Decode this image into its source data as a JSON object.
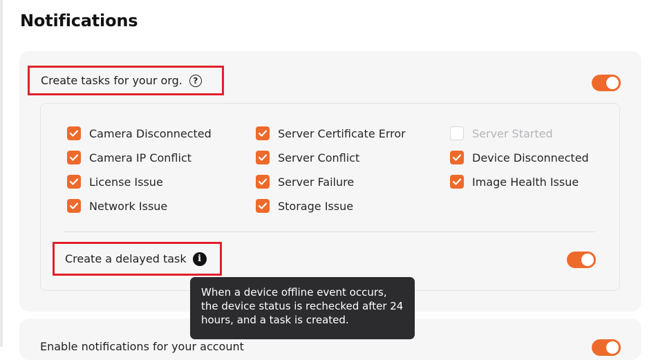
{
  "page": {
    "title": "Notifications"
  },
  "org_tasks": {
    "label": "Create tasks for your org.",
    "help_icon": "question-circle-icon",
    "enabled": true,
    "items": [
      {
        "label": "Camera Disconnected",
        "checked": true,
        "disabled": false
      },
      {
        "label": "Camera IP Conflict",
        "checked": true,
        "disabled": false
      },
      {
        "label": "License Issue",
        "checked": true,
        "disabled": false
      },
      {
        "label": "Network Issue",
        "checked": true,
        "disabled": false
      },
      {
        "label": "Server Certificate Error",
        "checked": true,
        "disabled": false
      },
      {
        "label": "Server Conflict",
        "checked": true,
        "disabled": false
      },
      {
        "label": "Server Failure",
        "checked": true,
        "disabled": false
      },
      {
        "label": "Storage Issue",
        "checked": true,
        "disabled": false
      },
      {
        "label": "Server Started",
        "checked": false,
        "disabled": true
      },
      {
        "label": "Device Disconnected",
        "checked": true,
        "disabled": false
      },
      {
        "label": "Image Health Issue",
        "checked": true,
        "disabled": false
      }
    ]
  },
  "delayed_task": {
    "label": "Create a delayed task",
    "info_icon": "info-circle-icon",
    "enabled": true,
    "tooltip": "When a device offline event occurs, the device status is rechecked after 24 hours, and a task is created."
  },
  "account_notifications": {
    "label": "Enable notifications for your account",
    "enabled": true
  },
  "colors": {
    "accent": "#ee6a2b",
    "highlight_border": "#e0202b",
    "tooltip_bg": "#2c2c2e"
  }
}
